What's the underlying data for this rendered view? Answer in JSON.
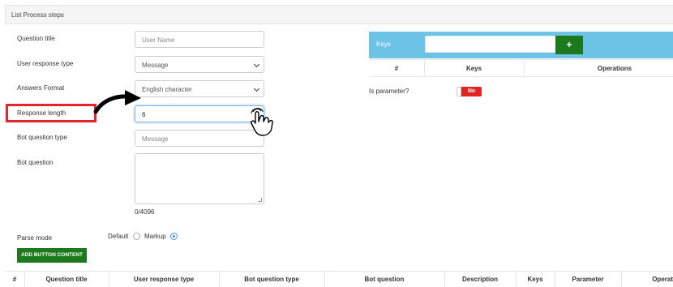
{
  "panel": {
    "title": "List Process steps"
  },
  "form": {
    "question_title_label": "Question title",
    "question_title_placeholder": "User Name",
    "user_response_type_label": "User response type",
    "user_response_type_value": "Message",
    "answers_format_label": "Answers Format",
    "answers_format_value": "English character",
    "response_length_label": "Response length",
    "response_length_value": "6",
    "bot_question_type_label": "Bot question type",
    "bot_question_type_placeholder": "Message",
    "bot_question_label": "Bot question",
    "bot_question_counter": "0/4096",
    "parse_mode_label": "Parse mode",
    "parse_mode_options": [
      "Default",
      "Markup"
    ],
    "parse_mode_selected": "Markup",
    "add_button_label": "ADD BUTTON CONTENT"
  },
  "keys_panel": {
    "title": "Keys",
    "add_icon": "+",
    "columns": [
      "#",
      "Keys",
      "Operations"
    ],
    "is_parameter_label": "Is parameter?",
    "is_parameter_value": "No"
  },
  "steps_table": {
    "columns": [
      "#",
      "Question title",
      "User response type",
      "Bot question type",
      "Bot question",
      "Description",
      "Keys",
      "Parameter",
      "Operat"
    ]
  },
  "annotations": {
    "highlight_color": "#e5252a",
    "accent_green": "#1c7a1c",
    "keys_bar_color": "#6cc3e6"
  }
}
